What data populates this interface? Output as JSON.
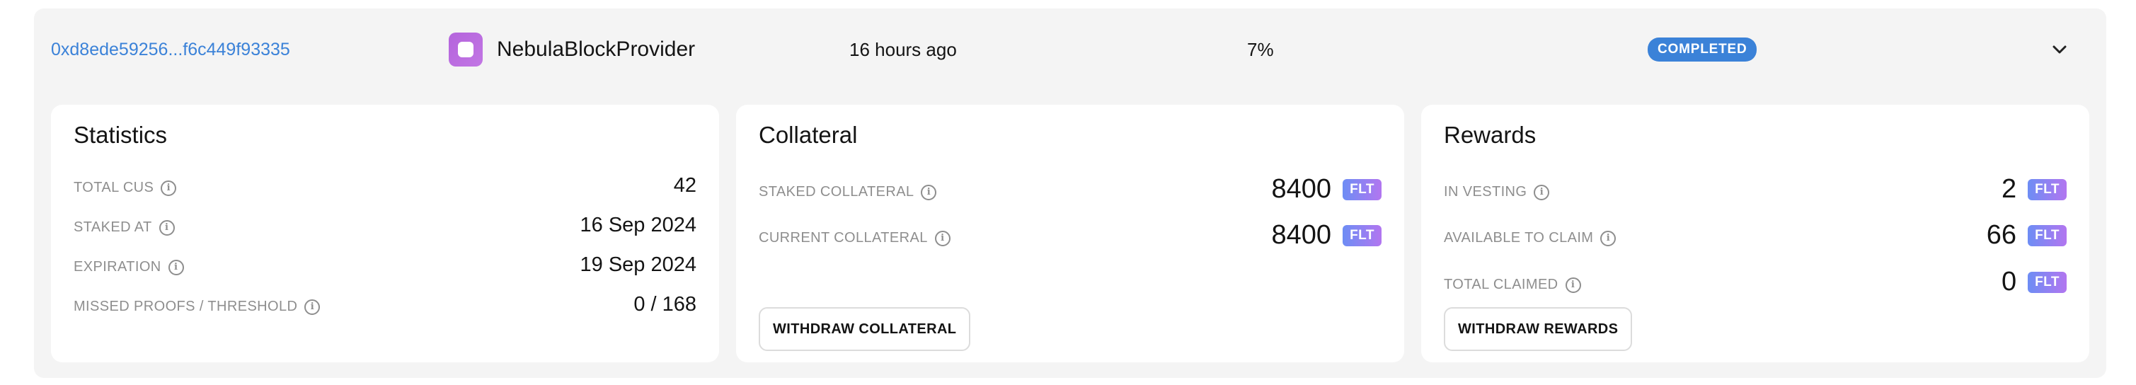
{
  "row": {
    "address": "0xd8ede59256...f6c449f93335",
    "provider": "NebulaBlockProvider",
    "time": "16 hours ago",
    "percent": "7%",
    "status": "COMPLETED",
    "expand_icon": "chevron-down-icon"
  },
  "statistics": {
    "title": "Statistics",
    "items": [
      {
        "label": "TOTAL CUS",
        "value": "42"
      },
      {
        "label": "STAKED AT",
        "value": "16 Sep 2024"
      },
      {
        "label": "EXPIRATION",
        "value": "19 Sep 2024"
      },
      {
        "label": "MISSED PROOFS / THRESHOLD",
        "value": "0 / 168"
      }
    ]
  },
  "collateral": {
    "title": "Collateral",
    "items": [
      {
        "label": "STAKED COLLATERAL",
        "value": "8400",
        "unit": "FLT"
      },
      {
        "label": "CURRENT COLLATERAL",
        "value": "8400",
        "unit": "FLT"
      }
    ],
    "button": "WITHDRAW COLLATERAL"
  },
  "rewards": {
    "title": "Rewards",
    "items": [
      {
        "label": "IN VESTING",
        "value": "2",
        "unit": "FLT"
      },
      {
        "label": "AVAILABLE TO CLAIM",
        "value": "66",
        "unit": "FLT"
      },
      {
        "label": "TOTAL CLAIMED",
        "value": "0",
        "unit": "FLT"
      }
    ],
    "button": "WITHDRAW REWARDS"
  },
  "colors": {
    "accent": "#3b82d8",
    "provider_avatar": "#b464dc",
    "token_badge_start": "#6d8df4",
    "token_badge_end": "#b276f0"
  }
}
